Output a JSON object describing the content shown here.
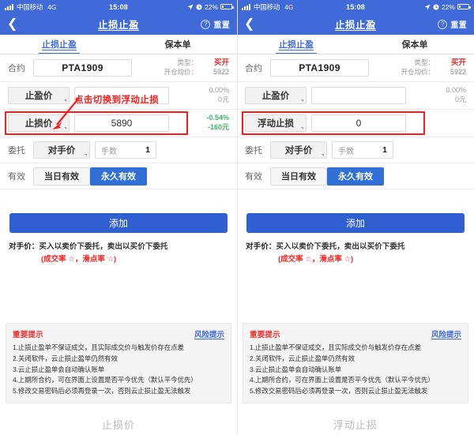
{
  "status_bar": {
    "carrier": "中国移动",
    "network": "4G",
    "time": "15:08",
    "battery_text": "22%",
    "battery_percent": 22,
    "location_icon": "location-arrow-icon",
    "alarm_icon": "alarm-clock-icon",
    "signal_icon": "signal-bars-icon"
  },
  "nav": {
    "back_icon": "chevron-left-icon",
    "title": "止损止盈",
    "help_icon": "question-mark-icon",
    "reset_label": "重置"
  },
  "tabs": [
    {
      "label": "止损止盈",
      "active": true
    },
    {
      "label": "保本单",
      "active": false
    }
  ],
  "contract": {
    "label": "合约",
    "value": "PTA1909",
    "type_label": "类型：",
    "type_value": "买开",
    "avg_label": "开仓均价：",
    "avg_value": "5922"
  },
  "take_profit": {
    "button_label": "止盈价",
    "input_value": "",
    "pl_percent": "0.00%",
    "pl_amount": "0元"
  },
  "left": {
    "stop_row": {
      "button_label": "止损价",
      "input_value": "5890",
      "pl_percent": "-0.54%",
      "pl_amount": "-160元"
    },
    "annotation": "点击切换到浮动止损",
    "caption": "止损价"
  },
  "right": {
    "stop_row": {
      "button_label": "浮动止损",
      "input_value": "0",
      "pl_percent": "",
      "pl_amount": ""
    },
    "caption": "浮动止损"
  },
  "entrust": {
    "label": "委托",
    "price_type": "对手价",
    "lots_label": "手数",
    "lots_value": "1"
  },
  "validity": {
    "label": "有效",
    "options": [
      {
        "label": "当日有效",
        "selected": false
      },
      {
        "label": "永久有效",
        "selected": true
      }
    ]
  },
  "add_button": {
    "label": "添加"
  },
  "hint": {
    "key": "对手价：",
    "text": "买入以卖价下委托，卖出以买价下委托",
    "sub": "(成交率 ☆，滑点率 ☆)"
  },
  "notice": {
    "title": "重要提示",
    "link": "风险提示",
    "items": [
      "1.止损止盈单不保证成交，且实际成交价与触发价存在点差",
      "2.关闭软件，云止损止盈单仍然有效",
      "3.云止损止盈单会自动确认账单",
      "4.上期所合约，可在界面上设置是否平今优先（默认平今优先）",
      "5.修改交易密码后必须再登录一次，否则云止损止盈无法触发"
    ]
  },
  "colors": {
    "brand_blue": "#3f6ad8",
    "button_blue": "#2f5fd0",
    "buy_red": "#e03131",
    "profit_green": "#3fb36a",
    "annotation_red": "#ff1a1a",
    "notice_bg": "#f5f5f5"
  }
}
